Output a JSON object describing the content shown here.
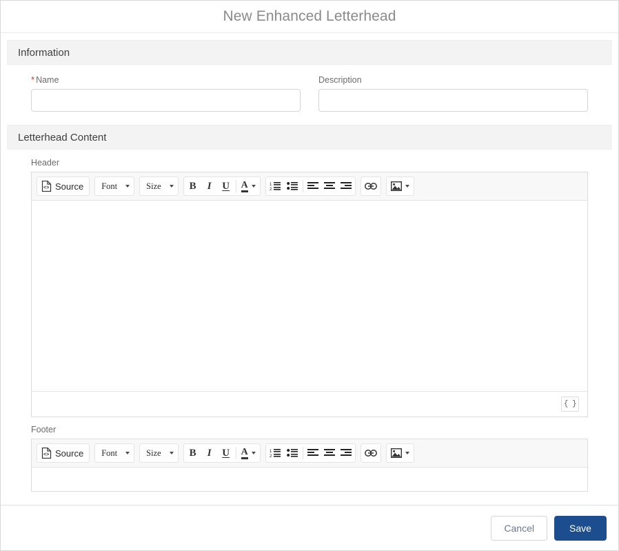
{
  "modal": {
    "title": "New Enhanced Letterhead"
  },
  "sections": {
    "information": {
      "title": "Information",
      "fields": {
        "name": {
          "label": "Name",
          "required_marker": "*",
          "value": "",
          "placeholder": ""
        },
        "description": {
          "label": "Description",
          "value": "",
          "placeholder": ""
        }
      }
    },
    "letterhead_content": {
      "title": "Letterhead Content",
      "header_editor": {
        "label": "Header",
        "content": "",
        "merge_field_label": "{ }"
      },
      "footer_editor": {
        "label": "Footer",
        "content": ""
      }
    }
  },
  "toolbar": {
    "source_label": "Source",
    "font_label": "Font",
    "size_label": "Size",
    "bold_label": "B",
    "italic_label": "I",
    "underline_label": "U",
    "text_color_label": "A",
    "icons": [
      "source-icon",
      "chevron-down-icon",
      "bold-icon",
      "italic-icon",
      "underline-icon",
      "text-color-icon",
      "numbered-list-icon",
      "bulleted-list-icon",
      "align-left-icon",
      "align-center-icon",
      "align-right-icon",
      "link-icon",
      "image-icon"
    ]
  },
  "footer_actions": {
    "cancel_label": "Cancel",
    "save_label": "Save"
  },
  "colors": {
    "brand_blue": "#1c4e8f",
    "required_red": "#c23934",
    "section_bg": "#f3f3f3",
    "toolbar_bg": "#f8f8f8",
    "title_gray": "#8a8a8a"
  }
}
